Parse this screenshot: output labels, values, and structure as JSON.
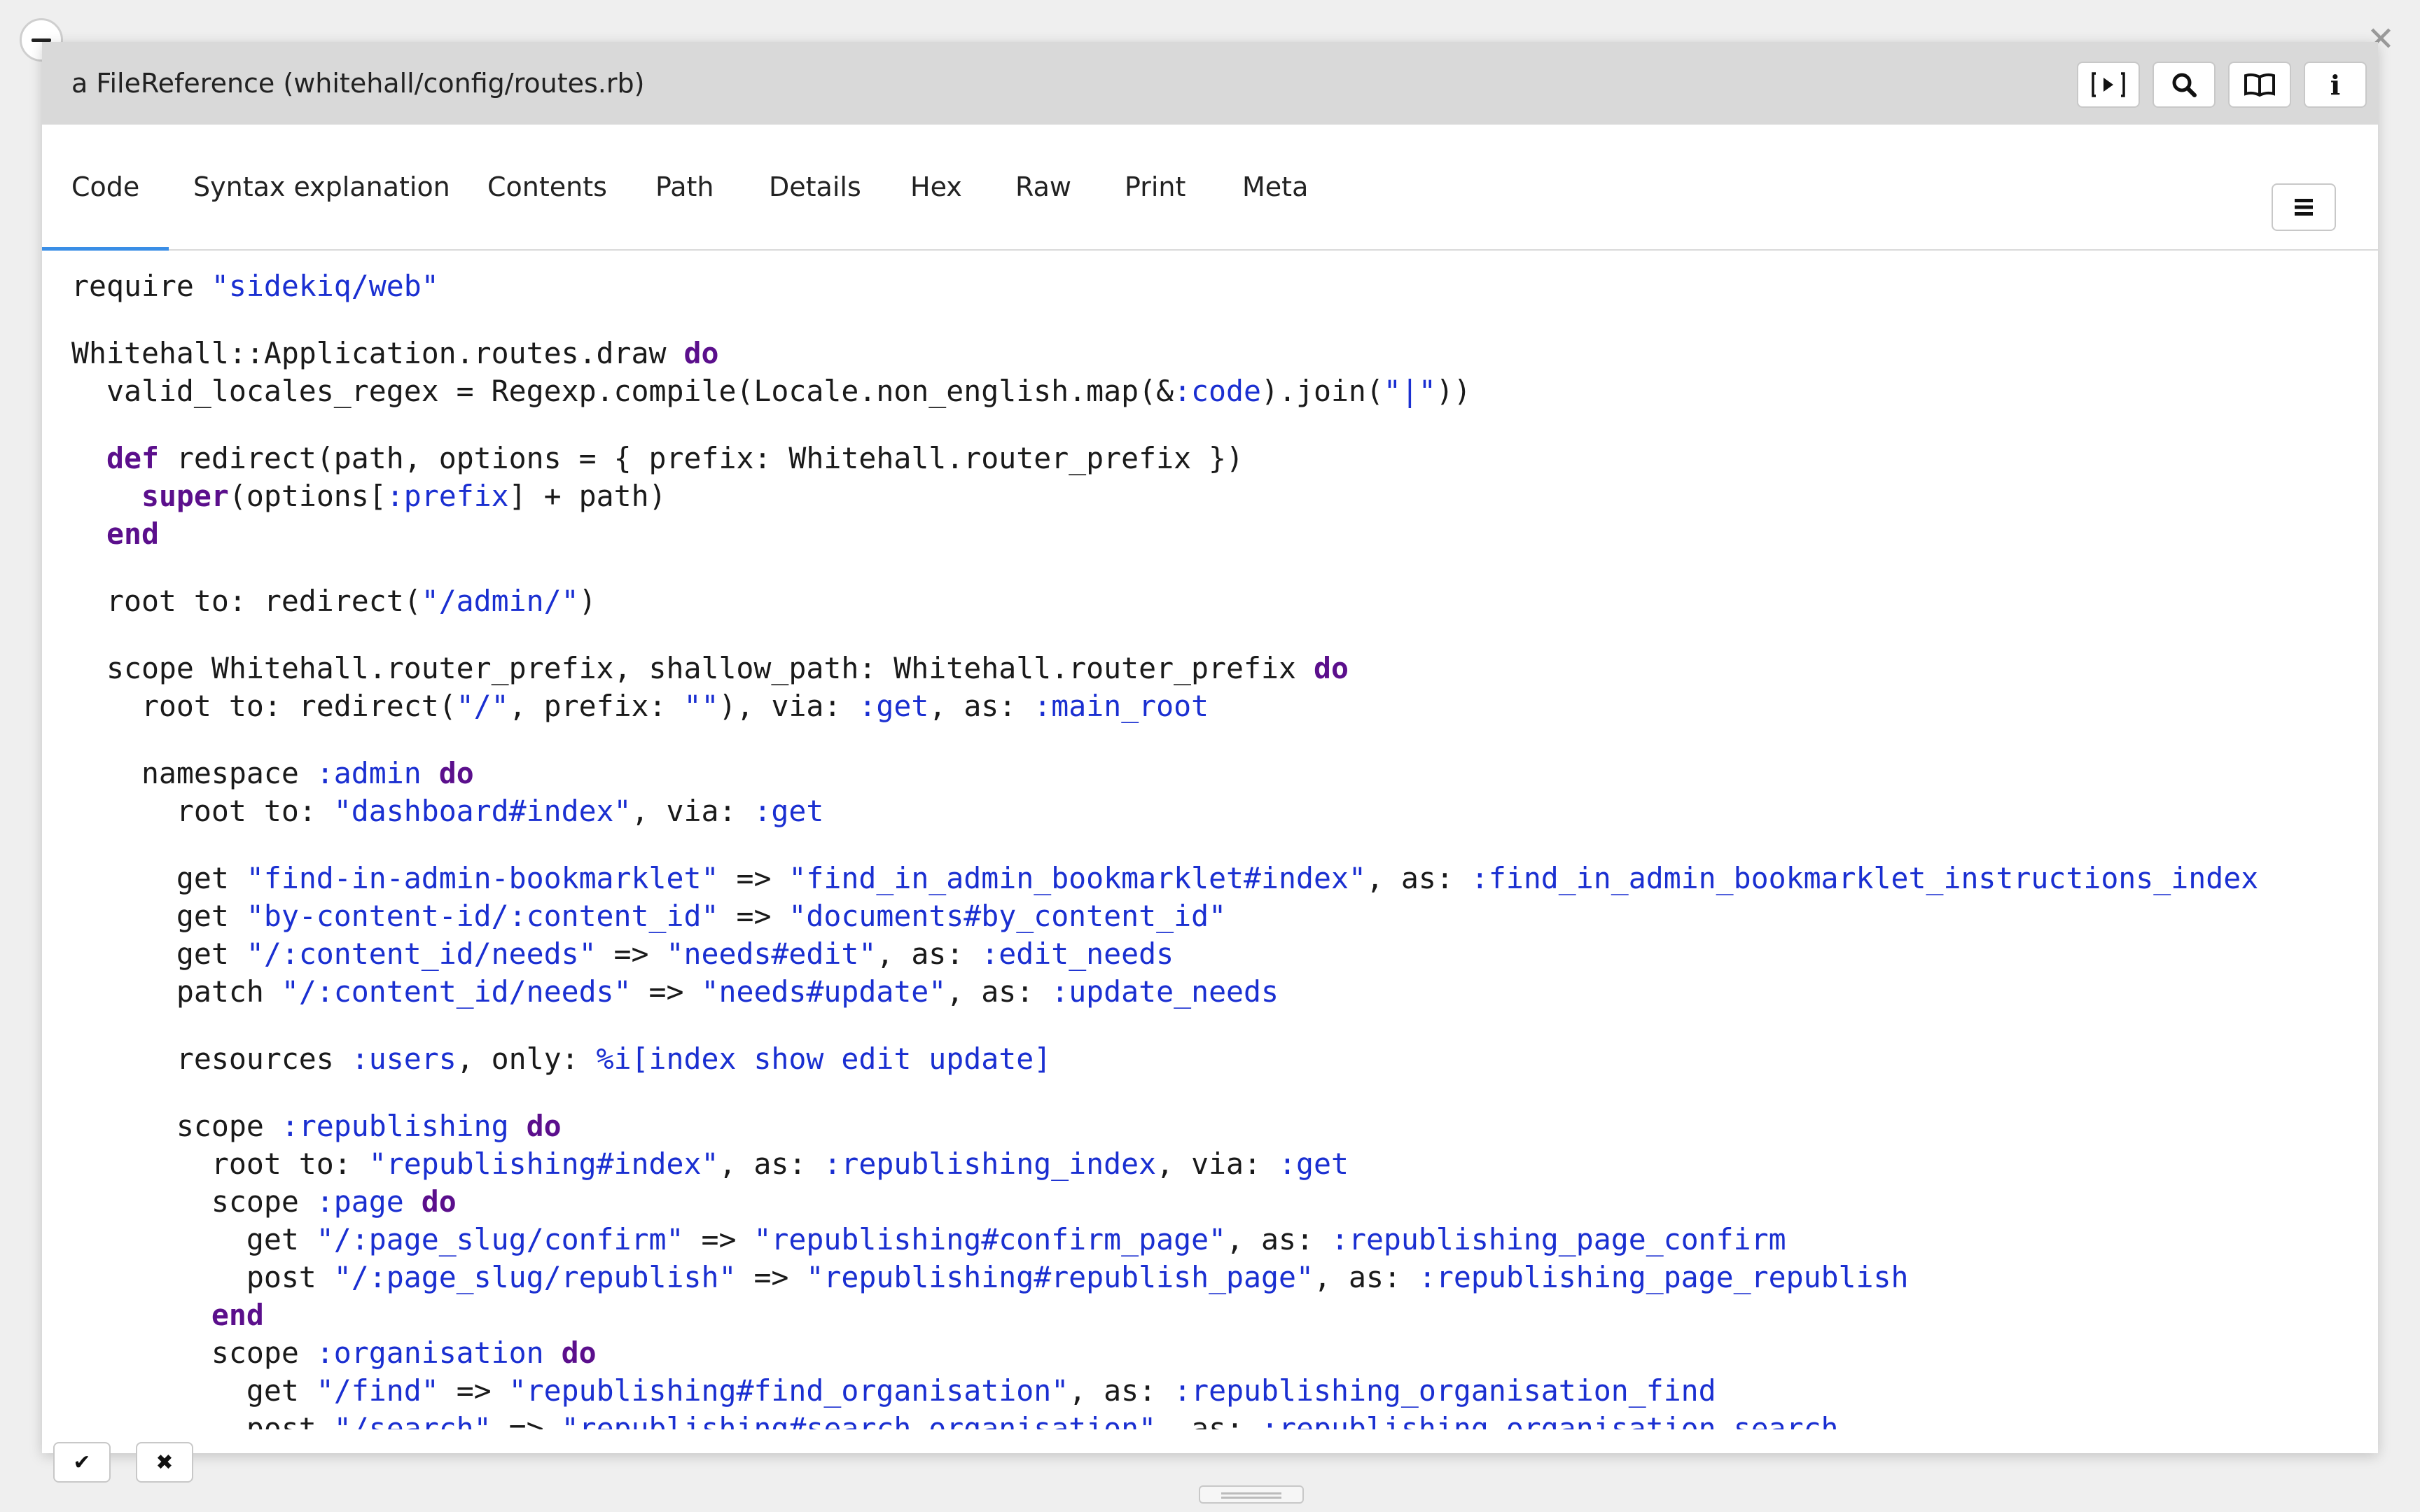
{
  "window": {
    "title": "a FileReference (whitehall/config/routes.rb)"
  },
  "toolbar_buttons": [
    {
      "icon": "play-bracket-icon",
      "glyph": "[▸]"
    },
    {
      "icon": "search-icon",
      "glyph": "🔍"
    },
    {
      "icon": "book-icon",
      "glyph": "📖"
    },
    {
      "icon": "info-icon",
      "glyph": "i"
    }
  ],
  "tabs": [
    {
      "label": "Code",
      "active": true
    },
    {
      "label": "Syntax explanation"
    },
    {
      "label": "Contents"
    },
    {
      "label": "Path"
    },
    {
      "label": "Details"
    },
    {
      "label": "Hex"
    },
    {
      "label": "Raw"
    },
    {
      "label": "Print"
    },
    {
      "label": "Meta"
    }
  ],
  "code_lines": [
    [
      [
        "t",
        "require "
      ],
      [
        "s",
        "\"sidekiq/web\""
      ]
    ],
    [],
    [
      [
        "t",
        "Whitehall::Application.routes.draw "
      ],
      [
        "k",
        "do"
      ]
    ],
    [
      [
        "t",
        "  valid_locales_regex = Regexp.compile(Locale.non_english.map(&"
      ],
      [
        "sym",
        ":code"
      ],
      [
        "t",
        ").join("
      ],
      [
        "s",
        "\"|\""
      ],
      [
        "t",
        "))"
      ]
    ],
    [],
    [
      [
        "t",
        "  "
      ],
      [
        "k",
        "def"
      ],
      [
        "t",
        " redirect(path, options = { prefix: Whitehall.router_prefix })"
      ]
    ],
    [
      [
        "t",
        "    "
      ],
      [
        "k",
        "super"
      ],
      [
        "t",
        "(options["
      ],
      [
        "sym",
        ":prefix"
      ],
      [
        "t",
        "] + path)"
      ]
    ],
    [
      [
        "t",
        "  "
      ],
      [
        "k",
        "end"
      ]
    ],
    [],
    [
      [
        "t",
        "  root to: redirect("
      ],
      [
        "s",
        "\"/admin/\""
      ],
      [
        "t",
        ")"
      ]
    ],
    [],
    [
      [
        "t",
        "  scope Whitehall.router_prefix, shallow_path: Whitehall.router_prefix "
      ],
      [
        "k",
        "do"
      ]
    ],
    [
      [
        "t",
        "    root to: redirect("
      ],
      [
        "s",
        "\"/\""
      ],
      [
        "t",
        ", prefix: "
      ],
      [
        "s",
        "\"\""
      ],
      [
        "t",
        "), via: "
      ],
      [
        "sym",
        ":get"
      ],
      [
        "t",
        ", as: "
      ],
      [
        "sym",
        ":main_root"
      ]
    ],
    [],
    [
      [
        "t",
        "    namespace "
      ],
      [
        "sym",
        ":admin"
      ],
      [
        "t",
        " "
      ],
      [
        "k",
        "do"
      ]
    ],
    [
      [
        "t",
        "      root to: "
      ],
      [
        "s",
        "\"dashboard#index\""
      ],
      [
        "t",
        ", via: "
      ],
      [
        "sym",
        ":get"
      ]
    ],
    [],
    [
      [
        "t",
        "      get "
      ],
      [
        "s",
        "\"find-in-admin-bookmarklet\""
      ],
      [
        "t",
        " => "
      ],
      [
        "s",
        "\"find_in_admin_bookmarklet#index\""
      ],
      [
        "t",
        ", as: "
      ],
      [
        "sym",
        ":find_in_admin_bookmarklet_instructions_index"
      ]
    ],
    [
      [
        "t",
        "      get "
      ],
      [
        "s",
        "\"by-content-id/:content_id\""
      ],
      [
        "t",
        " => "
      ],
      [
        "s",
        "\"documents#by_content_id\""
      ]
    ],
    [
      [
        "t",
        "      get "
      ],
      [
        "s",
        "\"/:content_id/needs\""
      ],
      [
        "t",
        " => "
      ],
      [
        "s",
        "\"needs#edit\""
      ],
      [
        "t",
        ", as: "
      ],
      [
        "sym",
        ":edit_needs"
      ]
    ],
    [
      [
        "t",
        "      patch "
      ],
      [
        "s",
        "\"/:content_id/needs\""
      ],
      [
        "t",
        " => "
      ],
      [
        "s",
        "\"needs#update\""
      ],
      [
        "t",
        ", as: "
      ],
      [
        "sym",
        ":update_needs"
      ]
    ],
    [],
    [
      [
        "t",
        "      resources "
      ],
      [
        "sym",
        ":users"
      ],
      [
        "t",
        ", only: "
      ],
      [
        "s",
        "%i[index show edit update]"
      ]
    ],
    [],
    [
      [
        "t",
        "      scope "
      ],
      [
        "sym",
        ":republishing"
      ],
      [
        "t",
        " "
      ],
      [
        "k",
        "do"
      ]
    ],
    [
      [
        "t",
        "        root to: "
      ],
      [
        "s",
        "\"republishing#index\""
      ],
      [
        "t",
        ", as: "
      ],
      [
        "sym",
        ":republishing_index"
      ],
      [
        "t",
        ", via: "
      ],
      [
        "sym",
        ":get"
      ]
    ],
    [
      [
        "t",
        "        scope "
      ],
      [
        "sym",
        ":page"
      ],
      [
        "t",
        " "
      ],
      [
        "k",
        "do"
      ]
    ],
    [
      [
        "t",
        "          get "
      ],
      [
        "s",
        "\"/:page_slug/confirm\""
      ],
      [
        "t",
        " => "
      ],
      [
        "s",
        "\"republishing#confirm_page\""
      ],
      [
        "t",
        ", as: "
      ],
      [
        "sym",
        ":republishing_page_confirm"
      ]
    ],
    [
      [
        "t",
        "          post "
      ],
      [
        "s",
        "\"/:page_slug/republish\""
      ],
      [
        "t",
        " => "
      ],
      [
        "s",
        "\"republishing#republish_page\""
      ],
      [
        "t",
        ", as: "
      ],
      [
        "sym",
        ":republishing_page_republish"
      ]
    ],
    [
      [
        "t",
        "        "
      ],
      [
        "k",
        "end"
      ]
    ],
    [
      [
        "t",
        "        scope "
      ],
      [
        "sym",
        ":organisation"
      ],
      [
        "t",
        " "
      ],
      [
        "k",
        "do"
      ]
    ],
    [
      [
        "t",
        "          get "
      ],
      [
        "s",
        "\"/find\""
      ],
      [
        "t",
        " => "
      ],
      [
        "s",
        "\"republishing#find_organisation\""
      ],
      [
        "t",
        ", as: "
      ],
      [
        "sym",
        ":republishing_organisation_find"
      ]
    ],
    [
      [
        "t",
        "          post "
      ],
      [
        "s",
        "\"/search\""
      ],
      [
        "t",
        " => "
      ],
      [
        "s",
        "\"republishing#search_organisation\""
      ],
      [
        "t",
        ", as: "
      ],
      [
        "sym",
        ":republishing_organisation_search"
      ]
    ]
  ],
  "bottom_buttons": [
    {
      "icon": "checkmark-icon",
      "glyph": "✔"
    },
    {
      "icon": "close-icon",
      "glyph": "✖"
    }
  ],
  "colors": {
    "string": "#1a2fd1",
    "keyword": "#5b0f8c",
    "tab_underline": "#3a8ee6"
  }
}
